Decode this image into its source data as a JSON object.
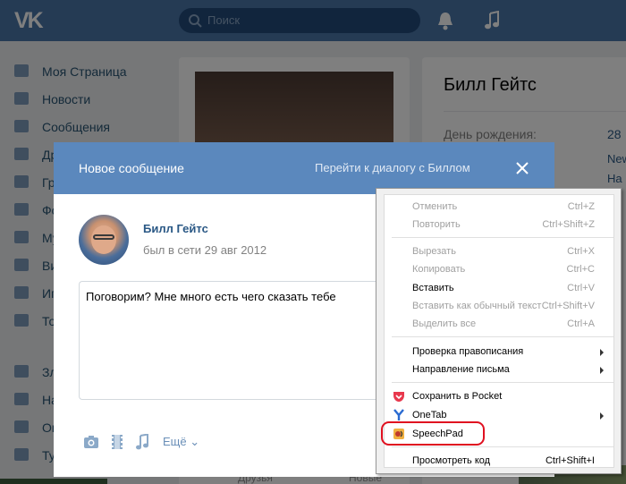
{
  "topbar": {
    "logo_text": "VK",
    "search_placeholder": "Поиск"
  },
  "left_menu": {
    "items": [
      {
        "label": "Моя Страница",
        "icon": "home-icon"
      },
      {
        "label": "Новости",
        "icon": "news-icon"
      },
      {
        "label": "Сообщения",
        "icon": "messages-icon"
      },
      {
        "label": "Др",
        "icon": "friends-icon"
      },
      {
        "label": "Гр",
        "icon": "groups-icon"
      },
      {
        "label": "Фо",
        "icon": "photos-icon"
      },
      {
        "label": "Му",
        "icon": "music-icon"
      },
      {
        "label": "Ви",
        "icon": "video-icon"
      },
      {
        "label": "Иг",
        "icon": "games-icon"
      },
      {
        "label": "То",
        "icon": "goods-icon"
      },
      {
        "label": "Зл",
        "icon": "stack-icon"
      },
      {
        "label": "На",
        "icon": "stack-icon"
      },
      {
        "label": "Ок",
        "icon": "stack-icon"
      },
      {
        "label": "Ту",
        "icon": "stack-icon"
      }
    ]
  },
  "profile": {
    "name": "Билл Гейтс",
    "birthday_label": "День рождения:",
    "birthday_value": "28",
    "line2": "New",
    "line3": "Ha",
    "friends_label": "Друзья",
    "news_label": "Новые"
  },
  "modal": {
    "title": "Новое сообщение",
    "dialog_link": "Перейти к диалогу с Биллом",
    "recipient_name": "Билл Гейтс",
    "recipient_status": "был в сети 29 авг 2012",
    "message_text": "Поговорим? Мне много есть чего сказать тебе",
    "more_label": "Ещё"
  },
  "context_menu": {
    "items": [
      {
        "label": "Отменить",
        "shortcut": "Ctrl+Z",
        "disabled": true
      },
      {
        "label": "Повторить",
        "shortcut": "Ctrl+Shift+Z",
        "disabled": true
      },
      {
        "label": "Вырезать",
        "shortcut": "Ctrl+X",
        "disabled": true
      },
      {
        "label": "Копировать",
        "shortcut": "Ctrl+C",
        "disabled": true
      },
      {
        "label": "Вставить",
        "shortcut": "Ctrl+V",
        "disabled": false
      },
      {
        "label": "Вставить как обычный текст",
        "shortcut": "Ctrl+Shift+V",
        "disabled": true
      },
      {
        "label": "Выделить все",
        "shortcut": "Ctrl+A",
        "disabled": true
      },
      {
        "label": "Проверка правописания",
        "shortcut": "",
        "disabled": false,
        "submenu": true
      },
      {
        "label": "Направление письма",
        "shortcut": "",
        "disabled": false,
        "submenu": true
      },
      {
        "label": "Сохранить в Pocket",
        "shortcut": "",
        "disabled": false,
        "icon": "pocket-icon"
      },
      {
        "label": "OneTab",
        "shortcut": "",
        "disabled": false,
        "submenu": true,
        "icon": "onetab-icon"
      },
      {
        "label": "SpeechPad",
        "shortcut": "",
        "disabled": false,
        "icon": "speechpad-icon"
      },
      {
        "label": "Просмотреть код",
        "shortcut": "Ctrl+Shift+I",
        "disabled": false
      }
    ],
    "highlight_color": "#e01020"
  },
  "colors": {
    "topbar": "#4a76a8",
    "modal_header": "#5b88bd",
    "link": "#2a5885"
  }
}
